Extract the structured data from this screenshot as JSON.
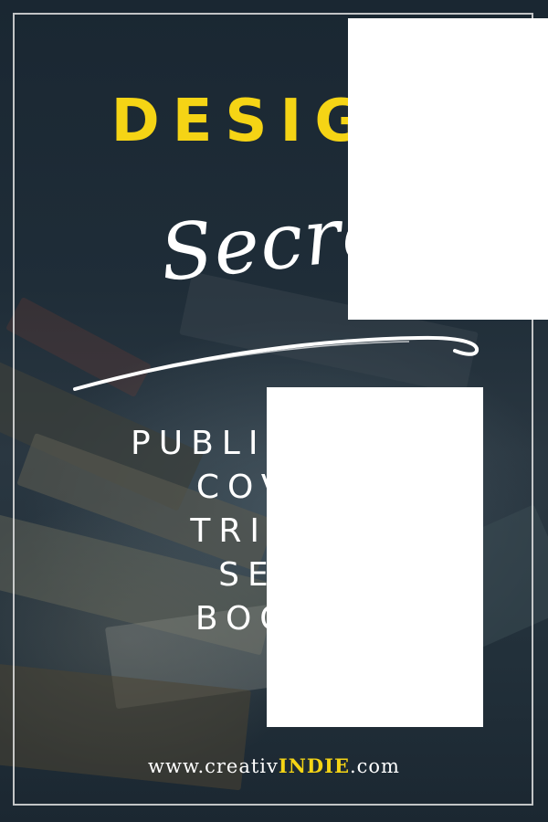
{
  "poster": {
    "title": "DESIGN",
    "script_word": "Secrets",
    "subtitle_lines": [
      "PUBLISHERS",
      "COVER",
      "TRICKS",
      "SELL",
      "BOOKS"
    ],
    "footer": {
      "prefix": "www.creativ",
      "highlight": "INDIE",
      "suffix": ".com"
    }
  },
  "colors": {
    "accent": "#f5d415",
    "text": "#ffffff",
    "background": "#1b2731"
  }
}
